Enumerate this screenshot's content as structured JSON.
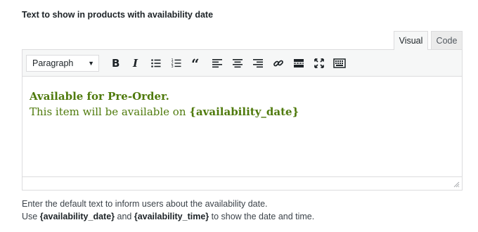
{
  "field": {
    "label": "Text to show in products with availability date"
  },
  "tabs": {
    "visual": "Visual",
    "code": "Code"
  },
  "toolbar": {
    "format_select": "Paragraph",
    "buttons": [
      {
        "name": "bold-icon"
      },
      {
        "name": "italic-icon"
      },
      {
        "name": "bulleted-list-icon"
      },
      {
        "name": "numbered-list-icon"
      },
      {
        "name": "blockquote-icon"
      },
      {
        "name": "align-left-icon"
      },
      {
        "name": "align-center-icon"
      },
      {
        "name": "align-right-icon"
      },
      {
        "name": "link-icon"
      },
      {
        "name": "read-more-icon"
      },
      {
        "name": "fullscreen-icon"
      },
      {
        "name": "toolbar-toggle-icon"
      }
    ]
  },
  "content": {
    "line1": "Available for Pre-Order.",
    "line2_prefix": "This item will be available on ",
    "line2_token": "{availability_date}",
    "text_color": "#4f7a0c"
  },
  "description": {
    "line1": "Enter the default text to inform users about the availability date.",
    "line2_a": "Use ",
    "token1": "{availability_date}",
    "line2_b": " and ",
    "token2": "{availability_time}",
    "line2_c": " to show the date and time."
  }
}
